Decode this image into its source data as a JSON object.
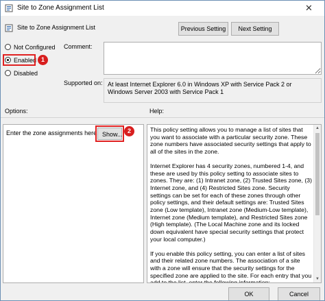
{
  "window": {
    "title": "Site to Zone Assignment List"
  },
  "policy": {
    "name": "Site to Zone Assignment List"
  },
  "nav": {
    "previous_label": "Previous Setting",
    "next_label": "Next Setting"
  },
  "state": {
    "options": [
      {
        "label": "Not Configured",
        "checked": false
      },
      {
        "label": "Enabled",
        "checked": true
      },
      {
        "label": "Disabled",
        "checked": false
      }
    ]
  },
  "comment": {
    "label": "Comment:",
    "value": ""
  },
  "supported": {
    "label": "Supported on:",
    "value": "At least Internet Explorer 6.0 in Windows XP with Service Pack 2 or Windows Server 2003 with Service Pack 1"
  },
  "options_section": {
    "label": "Options:",
    "zone_label": "Enter the zone assignments here.",
    "show_label": "Show..."
  },
  "help_section": {
    "label": "Help:",
    "paragraphs": [
      "This policy setting allows you to manage a list of sites that you want to associate with a particular security zone. These zone numbers have associated security settings that apply to all of the sites in the zone.",
      "Internet Explorer has 4 security zones, numbered 1-4, and these are used by this policy setting to associate sites to zones. They are: (1) Intranet zone, (2) Trusted Sites zone, (3) Internet zone, and (4) Restricted Sites zone. Security settings can be set for each of these zones through other policy settings, and their default settings are: Trusted Sites zone (Low template), Intranet zone (Medium-Low template), Internet zone (Medium template), and Restricted Sites zone (High template). (The Local Machine zone and its locked down equivalent have special security settings that protect your local computer.)",
      "If you enable this policy setting, you can enter a list of sites and their related zone numbers. The association of a site with a zone will ensure that the security settings for the specified zone are applied to the site.  For each entry that you add to the list, enter the following information:"
    ]
  },
  "annotations": {
    "badge1": "1",
    "badge2": "2"
  },
  "footer": {
    "ok_label": "OK",
    "cancel_label": "Cancel"
  },
  "colors": {
    "highlight": "#e02020",
    "badge": "#d81e1e"
  }
}
